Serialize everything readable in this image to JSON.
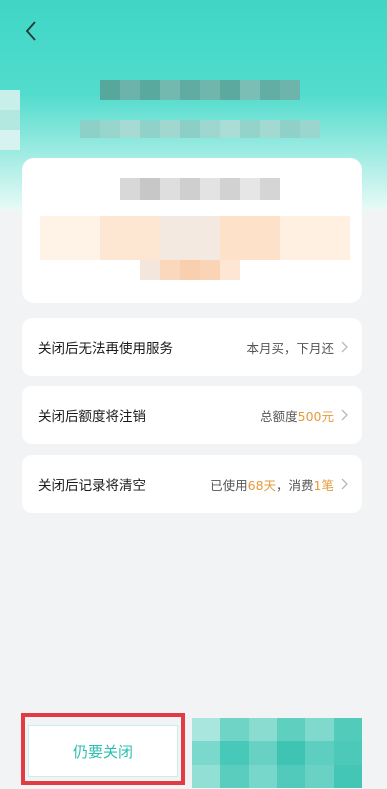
{
  "header": {
    "back_icon": "chevron-left-icon"
  },
  "rows": [
    {
      "label": "关闭后无法再使用服务",
      "right_parts": [
        {
          "text": "本月买，下月还",
          "highlight": false
        }
      ]
    },
    {
      "label": "关闭后额度将注销",
      "right_parts": [
        {
          "text": "总额度",
          "highlight": false
        },
        {
          "text": "500元",
          "highlight": true
        }
      ]
    },
    {
      "label": "关闭后记录将清空",
      "right_parts": [
        {
          "text": "已使用",
          "highlight": false
        },
        {
          "text": "68天",
          "highlight": true
        },
        {
          "text": "，消费",
          "highlight": false
        },
        {
          "text": "1笔",
          "highlight": true
        }
      ]
    }
  ],
  "bottom": {
    "close_button_label": "仍要关闭"
  },
  "colors": {
    "accent": "#2bbfae",
    "highlight_value": "#e69a39",
    "annotation_box": "#e23b43"
  }
}
